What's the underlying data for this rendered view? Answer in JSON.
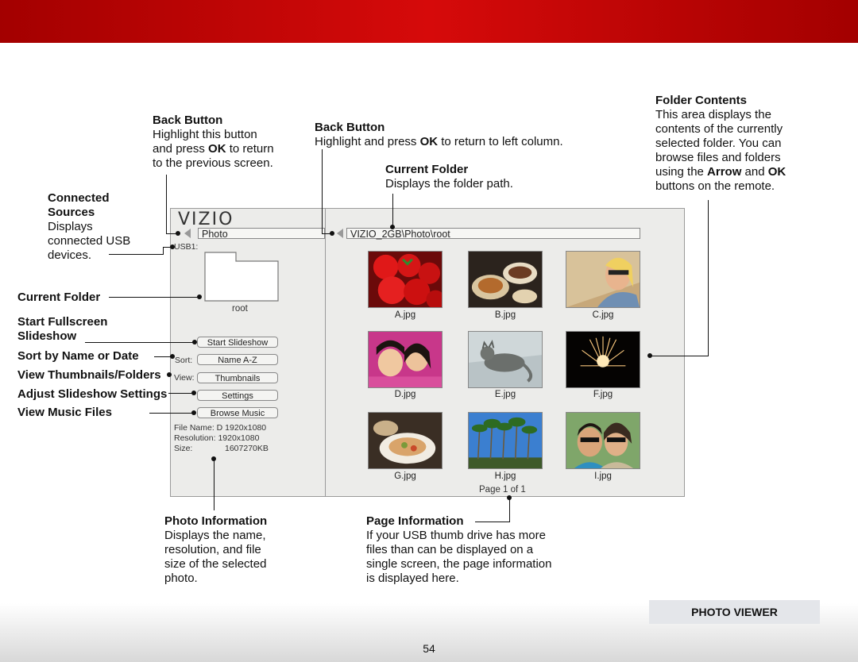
{
  "annotations": {
    "back_left": {
      "title": "Back Button",
      "l1": "Highlight this button",
      "l2a": "and press ",
      "l2b": "OK",
      "l2c": " to return",
      "l3": "to the previous screen."
    },
    "back_right": {
      "title": "Back Button",
      "l1a": "Highlight and press ",
      "l1b": "OK",
      "l1c": " to return to left column."
    },
    "current_folder_top": {
      "title": "Current Folder",
      "text": "Displays the folder path."
    },
    "folder_contents": {
      "title": "Folder Contents",
      "l1": "This area displays the",
      "l2": "contents of the currently",
      "l3": "selected folder. You can",
      "l4": "browse files and folders",
      "l5a": "using the ",
      "l5b": "Arrow",
      "l5c": " and ",
      "l5d": "OK",
      "l6": "buttons on the remote."
    },
    "connected_sources": {
      "t1": "Connected",
      "t2": "Sources",
      "l1": "Displays",
      "l2": "connected USB",
      "l3": "devices."
    },
    "current_folder_left": "Current Folder",
    "start_fullscreen_1": "Start Fullscreen",
    "start_fullscreen_2": "Slideshow",
    "sort": "Sort by Name or Date",
    "view": "View Thumbnails/Folders",
    "adjust": "Adjust Slideshow Settings",
    "music": "View Music Files",
    "photo_info": {
      "title": "Photo Information",
      "l1": "Displays the name,",
      "l2": "resolution, and file",
      "l3": "size of the selected",
      "l4": "photo."
    },
    "page_info": {
      "title": "Page Information",
      "l1": "If your USB thumb drive has more",
      "l2": "files than can be displayed on a",
      "l3": "single screen, the page information",
      "l4": "is displayed here."
    }
  },
  "screen": {
    "logo": "VIZIO",
    "left_path": "Photo",
    "right_path": "VIZIO_2GB\\Photo\\root",
    "usb_label": "USB1:",
    "folder_name": "root",
    "buttons": {
      "slideshow": "Start Slideshow",
      "sort_label": "Sort:",
      "sort_value": "Name A-Z",
      "view_label": "View:",
      "view_value": "Thumbnails",
      "settings": "Settings",
      "music": "Browse Music"
    },
    "info": {
      "file_name": "File Name: D 1920x1080",
      "resolution": "Resolution: 1920x1080",
      "size_label": "Size:",
      "size_value": "1607270KB"
    },
    "thumbnails": [
      "A.jpg",
      "B.jpg",
      "C.jpg",
      "D.jpg",
      "E.jpg",
      "F.jpg",
      "G.jpg",
      "H.jpg",
      "I.jpg"
    ],
    "page": "Page 1 of 1"
  },
  "footer": {
    "section": "PHOTO VIEWER",
    "page_number": "54"
  },
  "colors": {
    "header_red": "#c40000",
    "screen_bg": "#ececea"
  }
}
